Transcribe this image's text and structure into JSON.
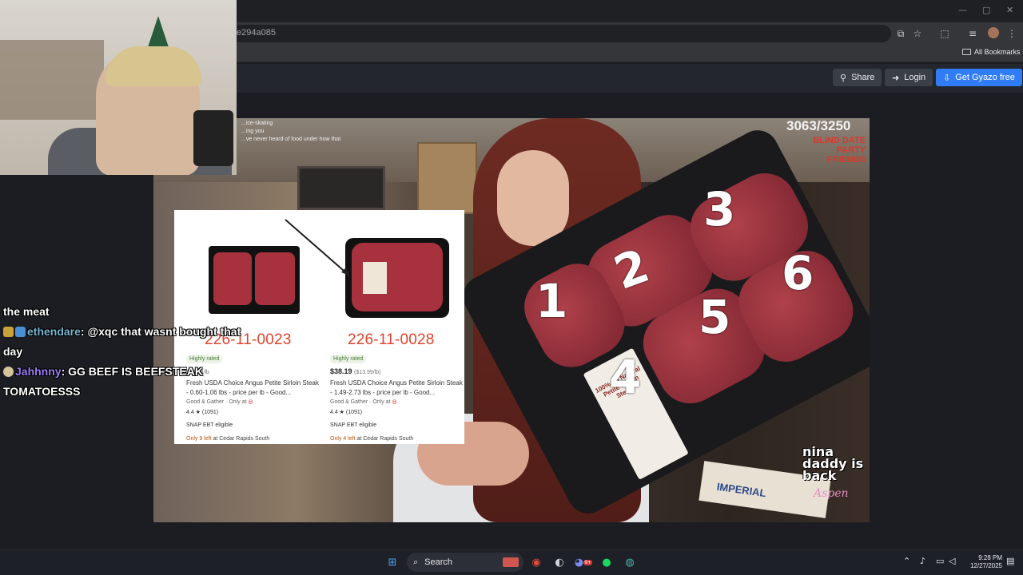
{
  "browser": {
    "url_fragment": "e294a085",
    "bookmarks_label": "All Bookmarks",
    "window_controls": {
      "minimize": "—",
      "restore": "▢",
      "close": "✕"
    }
  },
  "gyazo": {
    "share_label": "Share",
    "login_label": "Login",
    "get_label": "Get Gyazo free"
  },
  "video": {
    "counter": "3063/3250",
    "red_text": "BLIND DATE\nPARTY\nFRIENDS",
    "caption_lines": [
      "...ice-skating",
      "...ing you",
      "...ve never heard of food under how that"
    ],
    "digits": [
      "1",
      "2",
      "3",
      "4",
      "5",
      "6"
    ],
    "package_label": "100% All Natural Petite Sirloin Steak",
    "watermark": "nina daddy is back",
    "watermark_sig": "Aspen",
    "box_text": "IMPERIAL"
  },
  "products": [
    {
      "code": "226-11-0023",
      "badge": "Highly rated",
      "price": "",
      "unit_price": "$14.99/lb",
      "description": "Fresh USDA Choice Angus Petite Sirloin Steak - 0.60-1.06 lbs - price per lb - Good...",
      "brand": "Good & Gather",
      "only_at": "Only at",
      "rating": "4.4 ★ (1091)",
      "snap": "SNAP EBT eligible",
      "stock": "Only 9 left",
      "location": "at Cedar Rapids South"
    },
    {
      "code": "226-11-0028",
      "badge": "Highly rated",
      "price": "$38.19",
      "unit_price": "($13.99/lb)",
      "description": "Fresh USDA Choice Angus Petite Sirloin Steak - 1.49-2.73 lbs - price per lb - Good...",
      "brand": "Good & Gather",
      "only_at": "Only at",
      "rating": "4.4 ★ (1091)",
      "snap": "SNAP EBT eligible",
      "stock": "Only 4 left",
      "location": "at Cedar Rapids South"
    }
  ],
  "chat": {
    "line0": "the meat",
    "user1": "ethendare",
    "msg1": ": @xqc that wasnt bought that day",
    "user2": "Jahhnny",
    "msg2": ": GG BEEF IS BEEFSTEAK TOMATOESSS"
  },
  "taskbar": {
    "search_label": "Search",
    "time": "9:28 PM",
    "date": "12/27/2025",
    "discord_badge": "9+"
  },
  "colors": {
    "gyazo_primary": "#2f7cf5",
    "chat_user1": "#78b5cf",
    "chat_user2": "#9a7cf2",
    "product_code": "#e0432f"
  }
}
